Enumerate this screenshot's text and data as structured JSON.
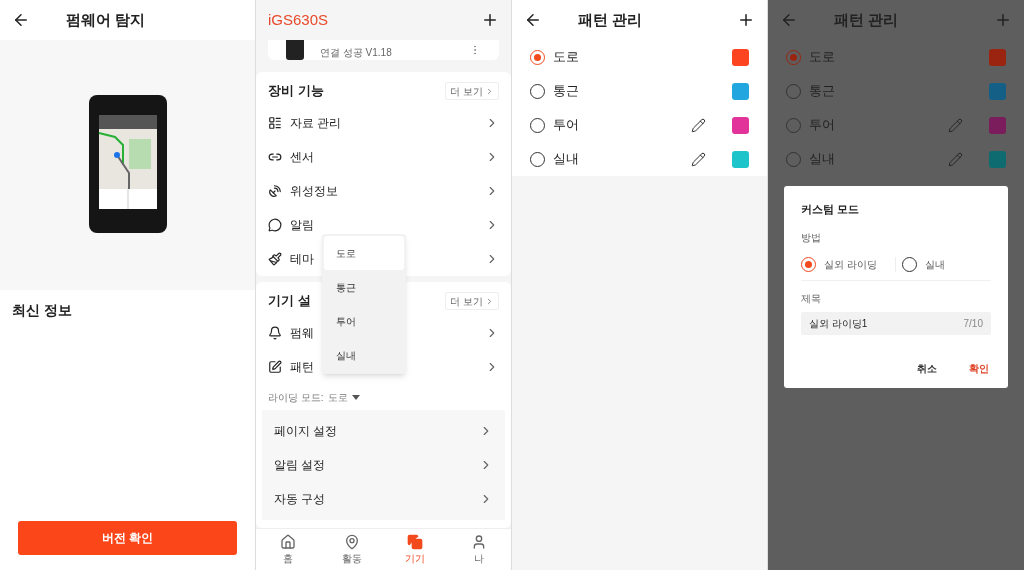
{
  "firmware_screen": {
    "title": "펌웨어 탐지",
    "section_title": "최신 정보",
    "button": "버전 확인"
  },
  "device_screen": {
    "title": "iGS630S",
    "device_status": "연결 성공 V1.18",
    "sections": [
      {
        "title": "장비 기능",
        "more": "더 보기",
        "items": [
          "자료 관리",
          "센서",
          "위성정보",
          "알림",
          "테마"
        ]
      },
      {
        "title": "기기 설",
        "more": "더 보기",
        "items": [
          "펌웨",
          "패턴"
        ]
      }
    ],
    "riding_mode": {
      "label": "라이딩 모드:",
      "value": "도로"
    },
    "settings": [
      "페이지 설정",
      "알림 설정",
      "자동 구성"
    ],
    "dropdown": [
      {
        "label": "도로",
        "selected": true
      },
      {
        "label": "통근",
        "selected": false
      },
      {
        "label": "투어",
        "selected": false
      },
      {
        "label": "실내",
        "selected": false
      }
    ],
    "nav": [
      {
        "label": "홈",
        "selected": false
      },
      {
        "label": "활동",
        "selected": false
      },
      {
        "label": "기기",
        "selected": true
      },
      {
        "label": "나",
        "selected": false
      }
    ]
  },
  "pattern_screen": {
    "title": "패턴 관리",
    "patterns": [
      {
        "label": "도로",
        "selected": true,
        "editable": false,
        "color": "#fc4520"
      },
      {
        "label": "통근",
        "selected": false,
        "editable": false,
        "color": "#22a6e0"
      },
      {
        "label": "투어",
        "selected": false,
        "editable": true,
        "color": "#e2339b"
      },
      {
        "label": "실내",
        "selected": false,
        "editable": true,
        "color": "#1dc4ca"
      }
    ]
  },
  "dialog_screen": {
    "title": "패턴 관리",
    "patterns": [
      {
        "label": "도로",
        "selected": true,
        "editable": false,
        "color": "#9a2410"
      },
      {
        "label": "통근",
        "selected": false,
        "editable": false,
        "color": "#145f86"
      },
      {
        "label": "투어",
        "selected": false,
        "editable": true,
        "color": "#7b1c5c"
      },
      {
        "label": "실내",
        "selected": false,
        "editable": true,
        "color": "#0e6b70"
      }
    ],
    "dialog": {
      "title": "커스텀 모드",
      "method_label": "방법",
      "methods": [
        {
          "label": "실외 라이딩",
          "selected": true
        },
        {
          "label": "실내",
          "selected": false
        }
      ],
      "name_label": "제목",
      "name_value": "실외 라이딩1",
      "counter": "7/10",
      "buttons": [
        {
          "label": "취소",
          "kind": "cancel"
        },
        {
          "label": "확인",
          "kind": "confirm"
        }
      ]
    }
  }
}
